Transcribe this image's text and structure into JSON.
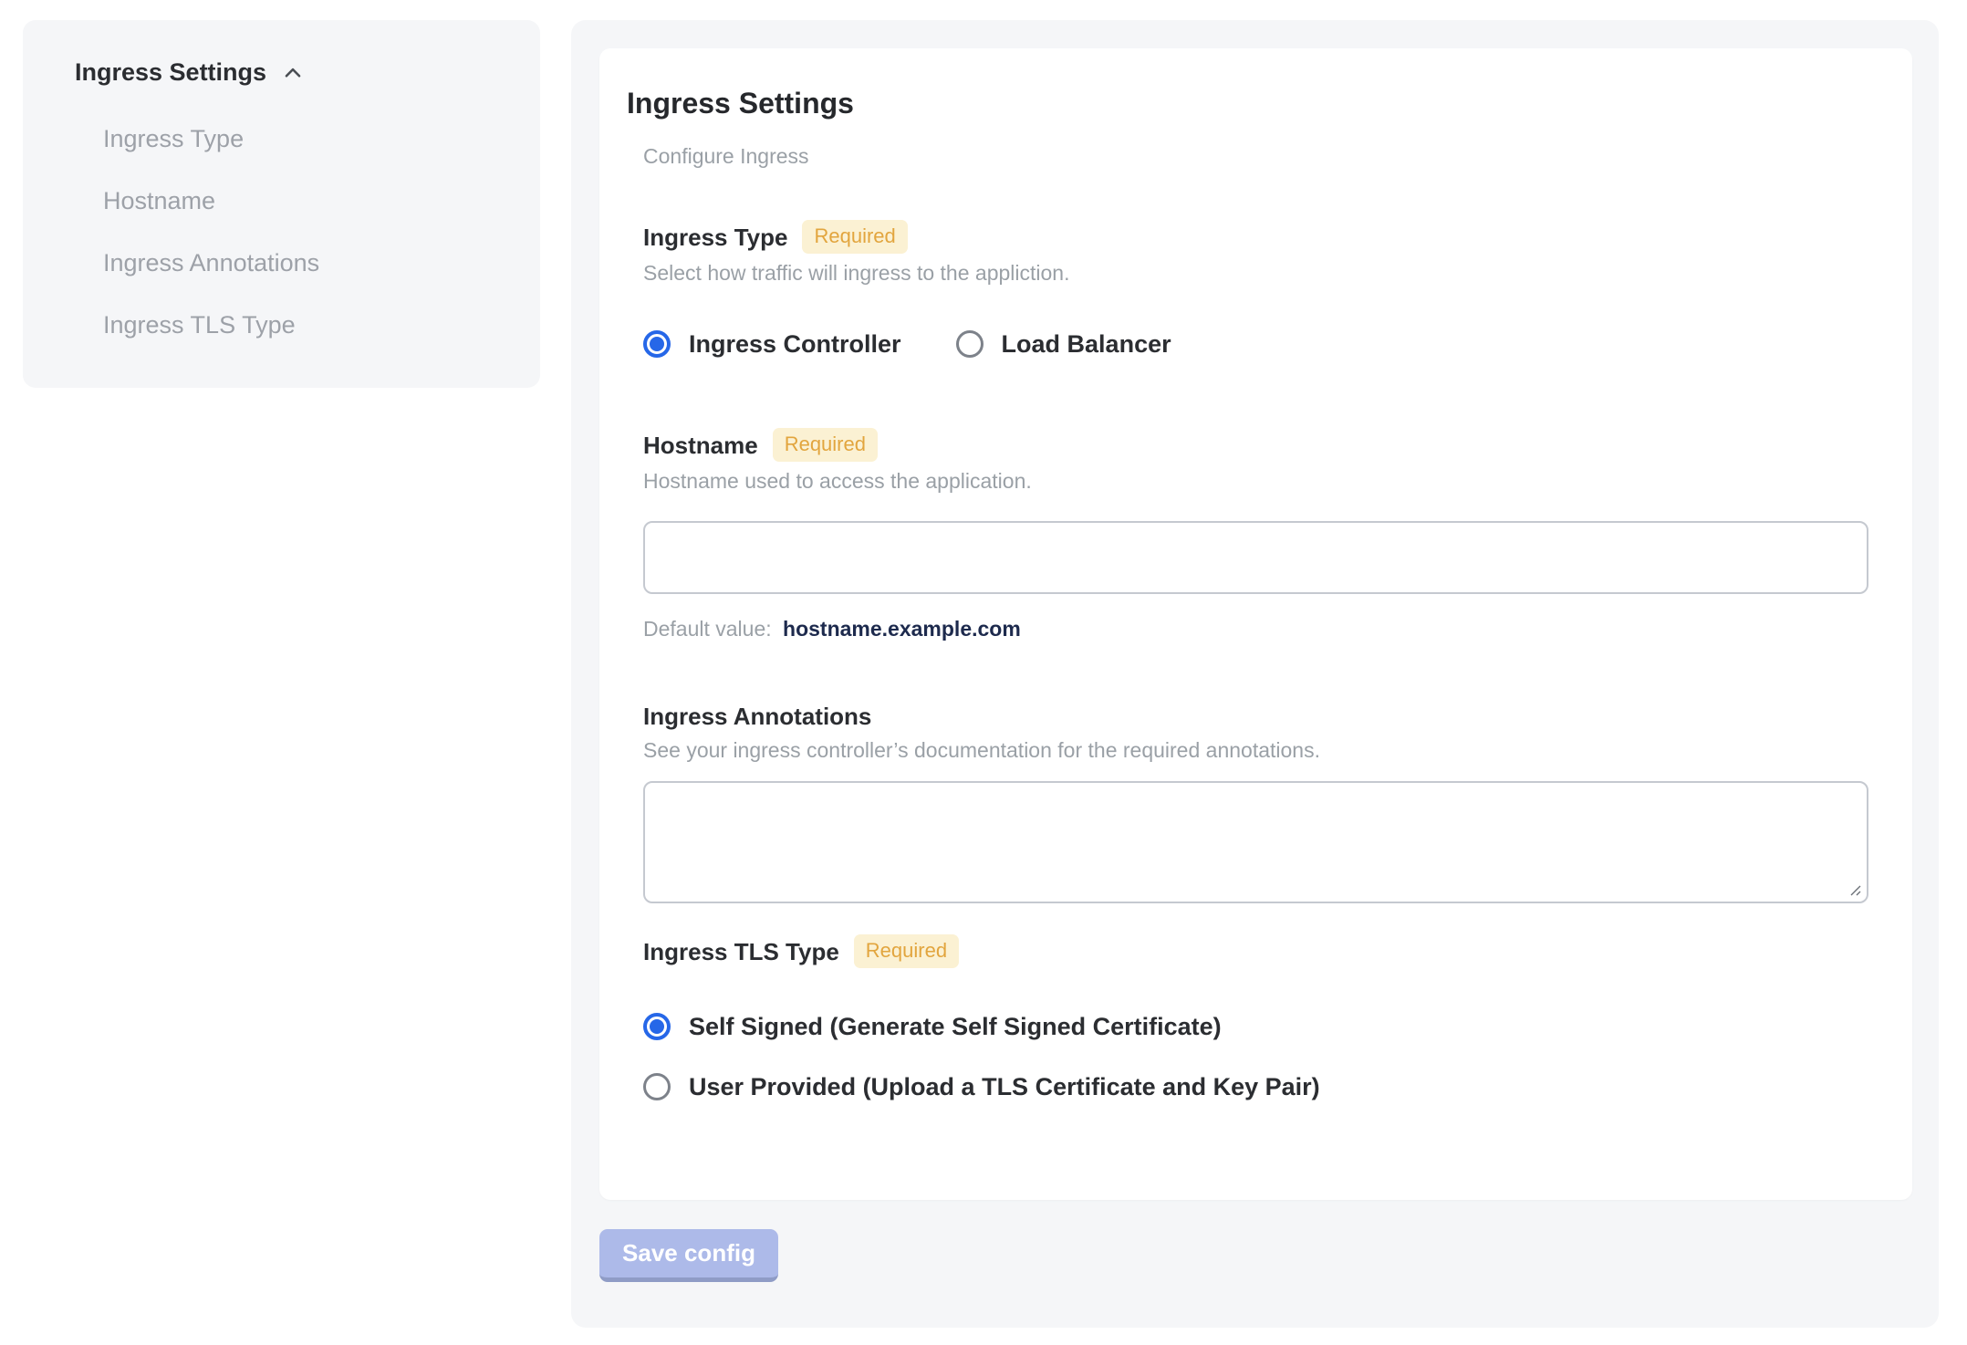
{
  "sidebar": {
    "title": "Ingress Settings",
    "items": [
      {
        "label": "Ingress Type"
      },
      {
        "label": "Hostname"
      },
      {
        "label": "Ingress Annotations"
      },
      {
        "label": "Ingress TLS Type"
      }
    ]
  },
  "main": {
    "title": "Ingress Settings",
    "subtitle": "Configure Ingress",
    "required_badge": "Required",
    "sections": {
      "ingress_type": {
        "label": "Ingress Type",
        "required": true,
        "description": "Select how traffic will ingress to the appliction.",
        "options": [
          {
            "label": "Ingress Controller",
            "selected": true
          },
          {
            "label": "Load Balancer",
            "selected": false
          }
        ]
      },
      "hostname": {
        "label": "Hostname",
        "required": true,
        "description": "Hostname used to access the application.",
        "value": "",
        "default_value_label": "Default value:",
        "default_value": "hostname.example.com"
      },
      "ingress_annotations": {
        "label": "Ingress Annotations",
        "required": false,
        "description": "See your ingress controller’s documentation for the required annotations.",
        "value": ""
      },
      "ingress_tls_type": {
        "label": "Ingress TLS Type",
        "required": true,
        "options": [
          {
            "label": "Self Signed (Generate Self Signed Certificate)",
            "selected": true
          },
          {
            "label": "User Provided (Upload a TLS Certificate and Key Pair)",
            "selected": false
          }
        ]
      }
    },
    "save_button": "Save config"
  },
  "colors": {
    "accent_blue": "#2667e8",
    "badge_bg": "#fbf1d3",
    "badge_text": "#e2a53e",
    "panel_bg": "#f5f6f8",
    "card_bg": "#ffffff",
    "muted_text": "#9aa0a6",
    "dark_text": "#26282c",
    "default_value_text": "#1d2a4d",
    "save_button_bg": "#adbae9",
    "save_button_edge": "#8f9cc6"
  }
}
